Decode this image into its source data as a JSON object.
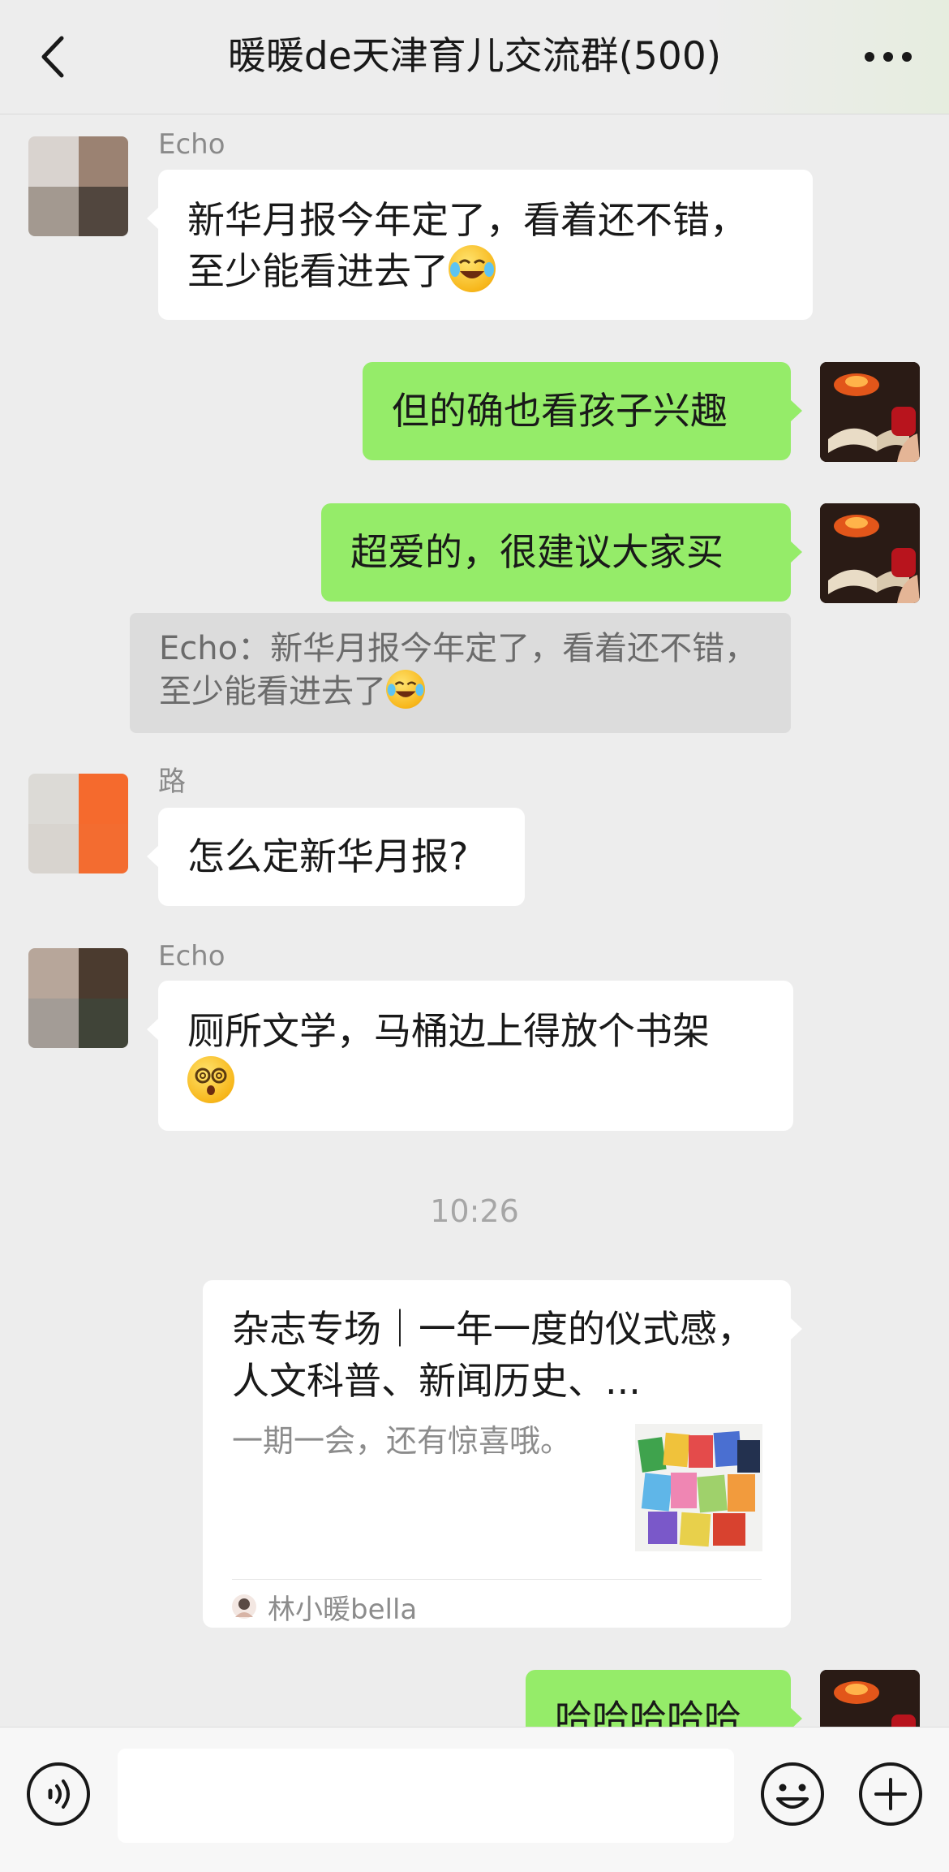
{
  "header": {
    "title": "暖暖de天津育儿交流群(500)",
    "back_icon": "chevron-left-icon",
    "more_icon": "ellipsis-icon"
  },
  "messages": [
    {
      "sender": "Echo",
      "text": "新华月报今年定了，看着还不错，至少能看进去了",
      "emoji": "laugh-cry-emoji"
    },
    {
      "text": "但的确也看孩子兴趣"
    },
    {
      "text": "超爱的，很建议大家买"
    },
    {
      "quote": "Echo：新华月报今年定了，看着还不错，至少能看进去了",
      "emoji": "laugh-cry-emoji"
    },
    {
      "sender": "路",
      "text": "怎么定新华月报?"
    },
    {
      "sender": "Echo",
      "text": "厕所文学，马桶边上得放个书架",
      "emoji": "dizzy-face-emoji"
    },
    {
      "timestamp": "10:26"
    },
    {
      "card": {
        "title": "杂志专场｜一年一度的仪式感，人文科普、新闻历史、...",
        "desc": "一期一会，还有惊喜哦。",
        "source": "林小暖bella"
      }
    },
    {
      "text": "哈哈哈哈哈"
    }
  ],
  "input": {
    "placeholder": ""
  },
  "colors": {
    "bubble_self": "#95ec69",
    "bubble_other": "#ffffff",
    "background": "#ededed"
  }
}
